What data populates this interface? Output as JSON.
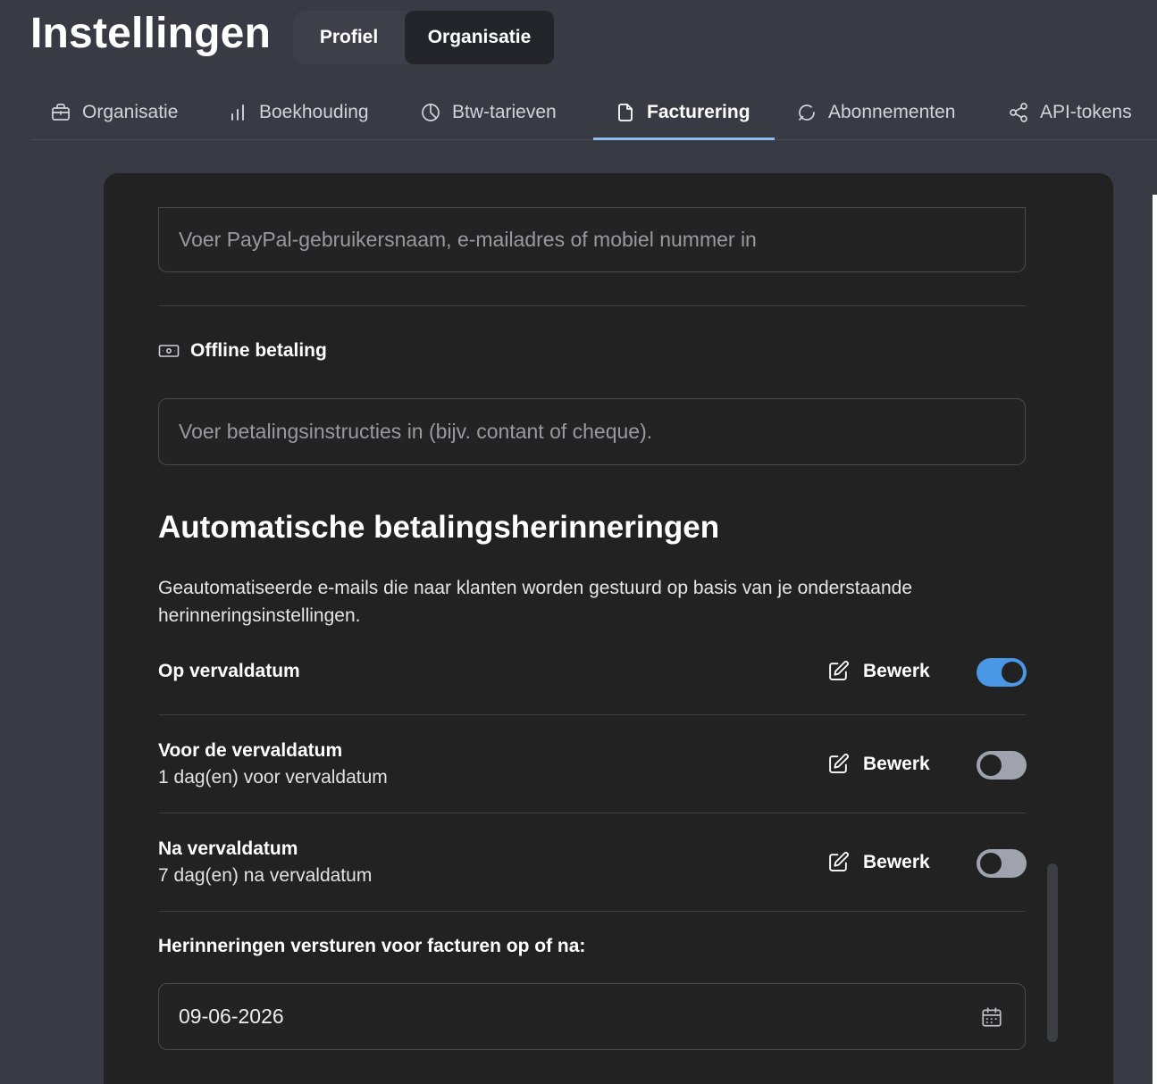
{
  "header": {
    "title": "Instellingen",
    "tabs": [
      {
        "label": "Profiel",
        "active": false
      },
      {
        "label": "Organisatie",
        "active": true
      }
    ]
  },
  "nav": {
    "tabs": [
      {
        "label": "Organisatie",
        "icon": "briefcase-icon"
      },
      {
        "label": "Boekhouding",
        "icon": "bar-chart-icon"
      },
      {
        "label": "Btw-tarieven",
        "icon": "pie-chart-icon"
      },
      {
        "label": "Facturering",
        "icon": "document-icon",
        "active": true
      },
      {
        "label": "Abonnementen",
        "icon": "refresh-icon"
      },
      {
        "label": "API-tokens",
        "icon": "share-icon"
      }
    ]
  },
  "paypal": {
    "placeholder": "Voer PayPal-gebruikersnaam, e-mailadres of mobiel nummer in"
  },
  "offline": {
    "title": "Offline betaling",
    "icon": "cash-icon",
    "placeholder": "Voer betalingsinstructies in (bijv. contant of cheque)."
  },
  "reminders": {
    "title": "Automatische betalingsherinneringen",
    "description": "Geautomatiseerde e-mails die naar klanten worden gestuurd op basis van je onderstaande herinneringsinstellingen.",
    "items": [
      {
        "title": "Op vervaldatum",
        "subtitle": "",
        "edit_label": "Bewerk",
        "enabled": true
      },
      {
        "title": "Voor de vervaldatum",
        "subtitle": "1 dag(en) voor vervaldatum",
        "edit_label": "Bewerk",
        "enabled": false
      },
      {
        "title": "Na vervaldatum",
        "subtitle": "7 dag(en) na vervaldatum",
        "edit_label": "Bewerk",
        "enabled": false
      }
    ],
    "date_label": "Herinneringen versturen voor facturen op of na:",
    "date_value": "09-06-2026"
  },
  "colors": {
    "accent": "#4a97e6",
    "tab_underline": "#8fbdf0",
    "card_bg": "#222222",
    "page_bg": "#383a44"
  }
}
